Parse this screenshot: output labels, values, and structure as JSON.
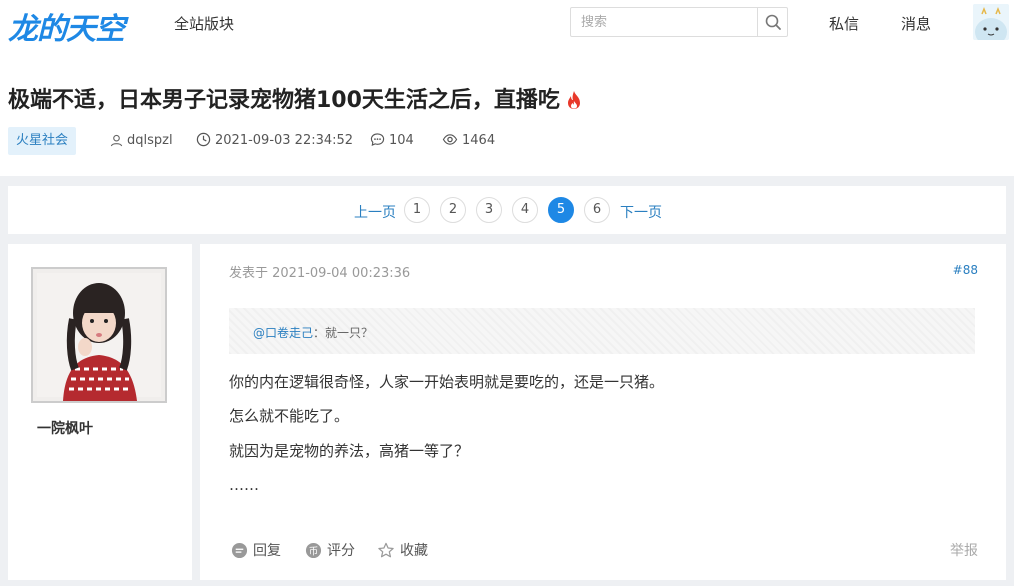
{
  "header": {
    "logo_text": "龙的天空",
    "nav_all": "全站版块",
    "search_placeholder": "搜索",
    "private_msg": "私信",
    "messages": "消息"
  },
  "thread": {
    "title": "极端不适，日本男子记录宠物猪100天生活之后，直播吃",
    "tag": "火星社会",
    "author": "dqlspzl",
    "date": "2021-09-03 22:34:52",
    "replies": "104",
    "views": "1464"
  },
  "pagination": {
    "prev": "上一页",
    "next": "下一页",
    "pages": [
      "1",
      "2",
      "3",
      "4",
      "5",
      "6"
    ],
    "current": "5"
  },
  "post": {
    "username": "一院枫叶",
    "posted_at": "发表于 2021-09-04 00:23:36",
    "floor": "#88",
    "quote_user": "@口卷走己",
    "quote_text": "：就一只？",
    "lines": [
      "你的内在逻辑很奇怪，人家一开始表明就是要吃的，还是一只猪。",
      "怎么就不能吃了。",
      "就因为是宠物的养法，高猪一等了？",
      "……"
    ],
    "actions": {
      "reply": "回复",
      "rate": "评分",
      "favorite": "收藏",
      "report": "举报"
    }
  },
  "colors": {
    "accent": "#1e88e5",
    "link": "#2a7fc0",
    "background": "#eef0f3"
  }
}
